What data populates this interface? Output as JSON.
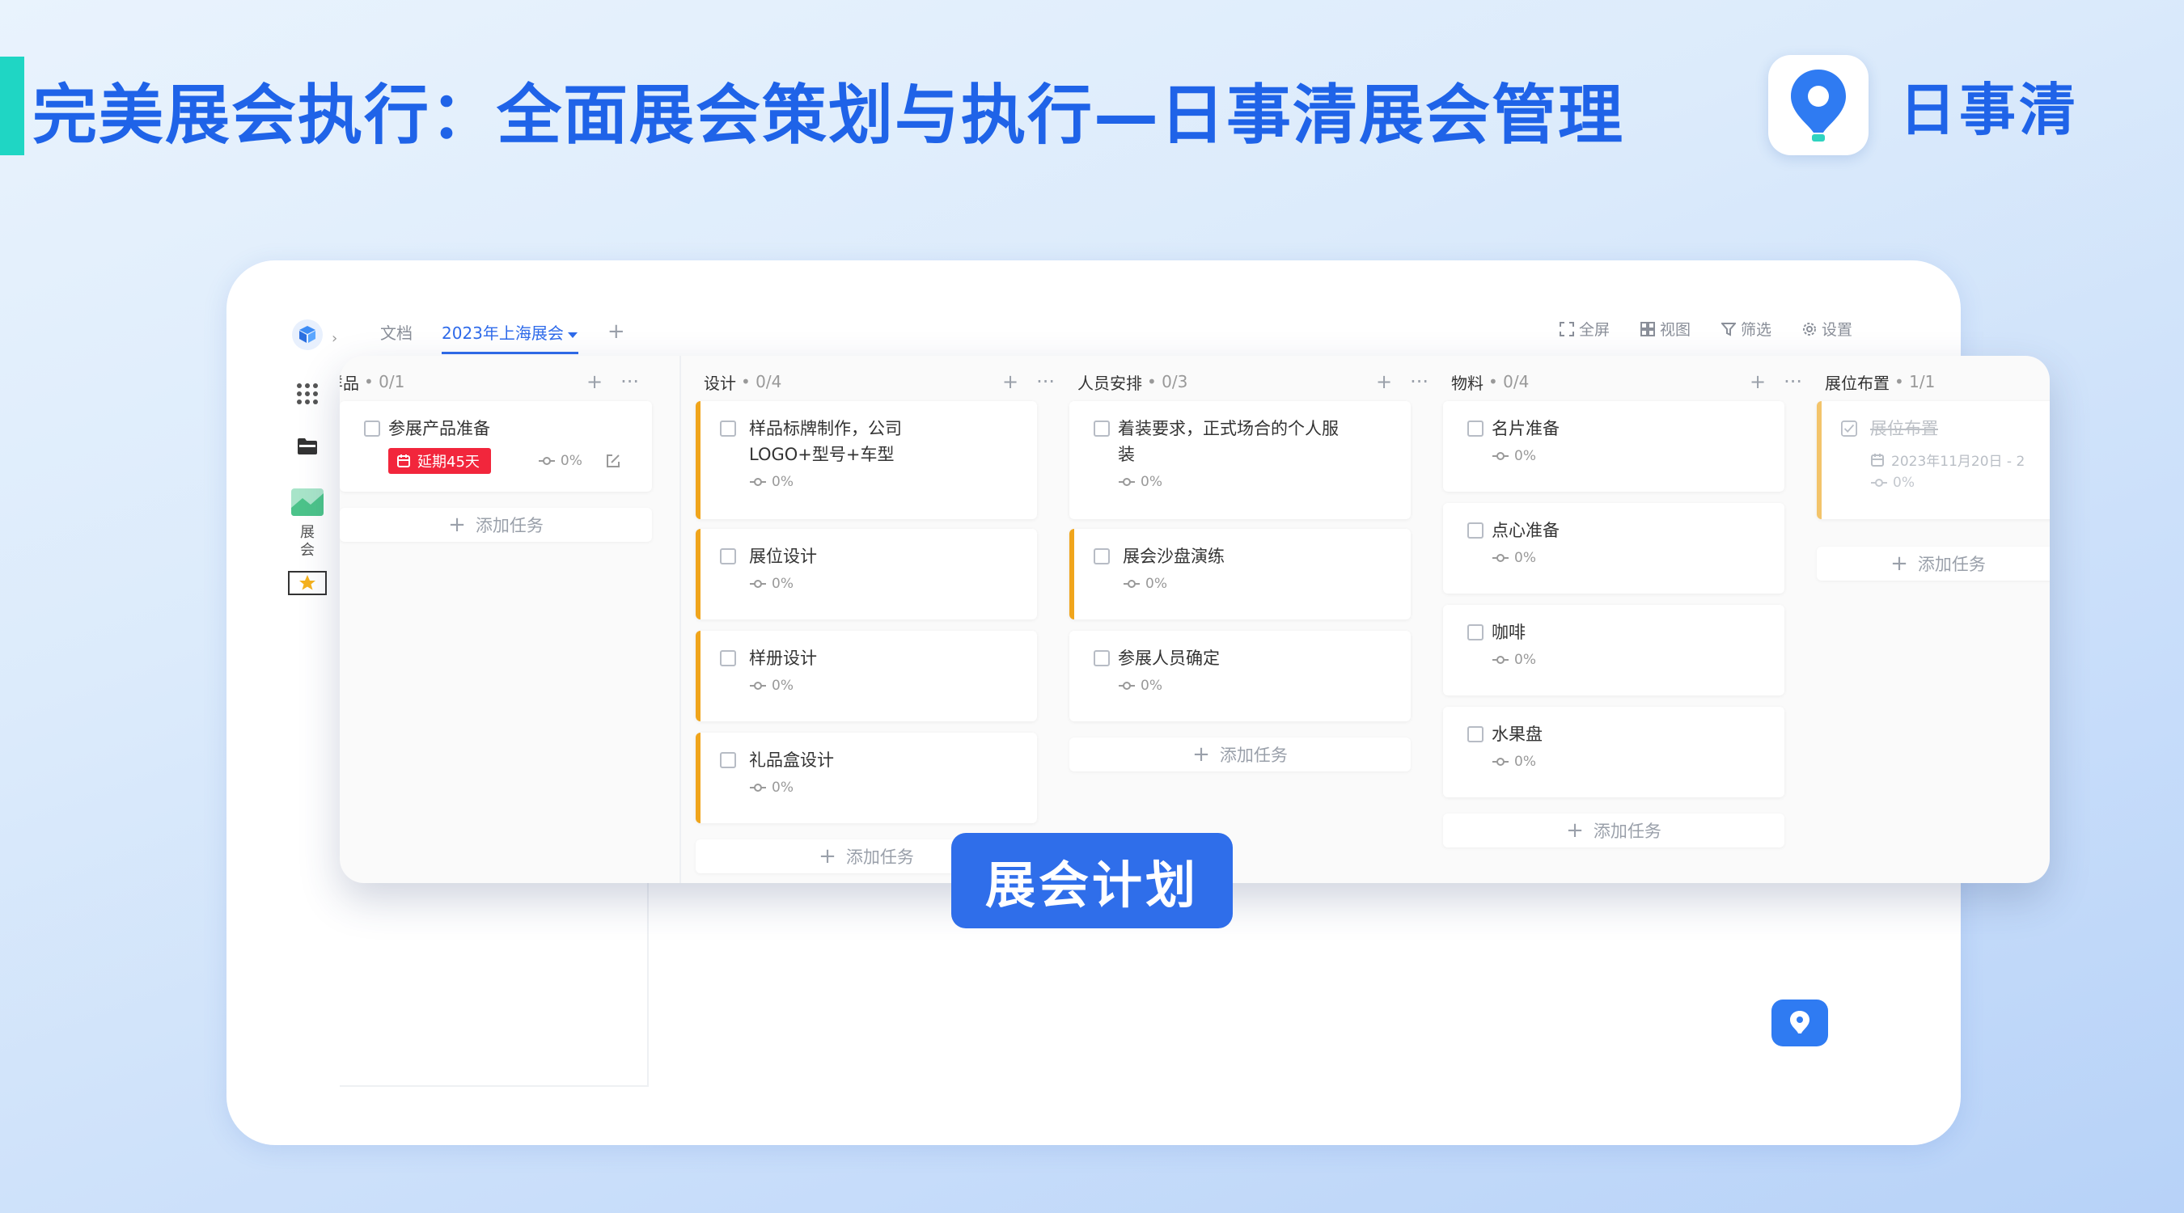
{
  "header": {
    "headline": "完美展会执行：全面展会策划与执行—日事清展会管理",
    "brand_name": "日事清"
  },
  "rail": {
    "items": [
      {
        "icon": "cube-icon"
      },
      {
        "icon": "grid-icon"
      },
      {
        "icon": "folder-icon"
      },
      {
        "icon": "project-icon",
        "label": "展会"
      },
      {
        "icon": "star-icon"
      }
    ],
    "label": "展会"
  },
  "tabs": {
    "doc": "文档",
    "active": "2023年上海展会",
    "add": "+"
  },
  "toolbar": {
    "fullscreen": "全屏",
    "view": "视图",
    "filter": "筛选",
    "settings": "设置"
  },
  "columns": [
    {
      "title": "样品",
      "count": "0/1",
      "tasks": [
        {
          "title": "参展产品准备",
          "overdue": "延期45天",
          "progress": "0%"
        }
      ]
    },
    {
      "title": "设计",
      "count": "0/4",
      "tasks": [
        {
          "title_line1": "样品标牌制作，公司",
          "title_line2": "LOGO+型号+车型",
          "progress": "0%"
        },
        {
          "title": "展位设计",
          "progress": "0%"
        },
        {
          "title": "样册设计",
          "progress": "0%"
        },
        {
          "title": "礼品盒设计",
          "progress": "0%"
        }
      ]
    },
    {
      "title": "人员安排",
      "count": "0/3",
      "tasks": [
        {
          "title_line1": "着装要求，正式场合的个人服",
          "title_line2": "装",
          "progress": "0%"
        },
        {
          "title": "展会沙盘演练",
          "progress": "0%"
        },
        {
          "title": "参展人员确定",
          "progress": "0%"
        }
      ]
    },
    {
      "title": "物料",
      "count": "0/4",
      "tasks": [
        {
          "title": "名片准备",
          "progress": "0%"
        },
        {
          "title": "点心准备",
          "progress": "0%"
        },
        {
          "title": "咖啡",
          "progress": "0%"
        },
        {
          "title": "水果盘",
          "progress": "0%"
        }
      ]
    },
    {
      "title": "展位布置",
      "count": "1/1",
      "tasks": [
        {
          "title": "展位布置",
          "date": "2023年11月20日 - 2",
          "progress": "0%"
        }
      ]
    }
  ],
  "add_task_label": "添加任务",
  "col_add": "+",
  "col_more": "···",
  "badge": "展会计划"
}
